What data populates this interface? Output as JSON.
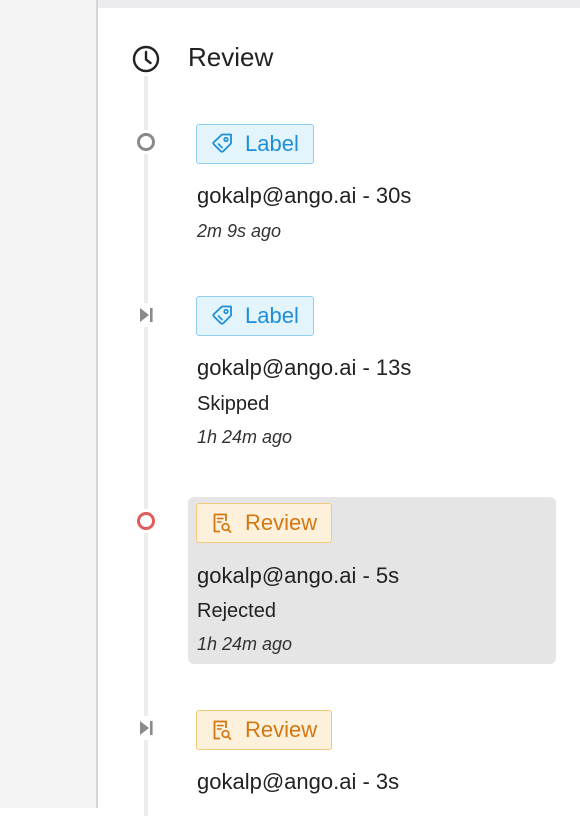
{
  "header": {
    "title": "Review",
    "icon": "clock-icon"
  },
  "colors": {
    "label_accent": "#1d8fd8",
    "review_accent": "#d27712",
    "rejected_marker": "#e05b5b",
    "neutral_marker": "#8a8a8a"
  },
  "entries": [
    {
      "marker": "circle-outline-icon",
      "tag": {
        "label": "Label",
        "icon": "tag-icon"
      },
      "user": "gokalp@ango.ai - 30s",
      "status": "",
      "time": "2m 9s ago"
    },
    {
      "marker": "skip-forward-icon",
      "tag": {
        "label": "Label",
        "icon": "tag-icon"
      },
      "user": "gokalp@ango.ai - 13s",
      "status": "Skipped",
      "time": "1h 24m ago"
    },
    {
      "marker": "circle-outline-red-icon",
      "tag": {
        "label": "Review",
        "icon": "review-doc-icon"
      },
      "user": "gokalp@ango.ai - 5s",
      "status": "Rejected",
      "time": "1h 24m ago",
      "selected": true
    },
    {
      "marker": "skip-forward-icon",
      "tag": {
        "label": "Review",
        "icon": "review-doc-icon"
      },
      "user": "gokalp@ango.ai - 3s",
      "status": "",
      "time": ""
    }
  ]
}
